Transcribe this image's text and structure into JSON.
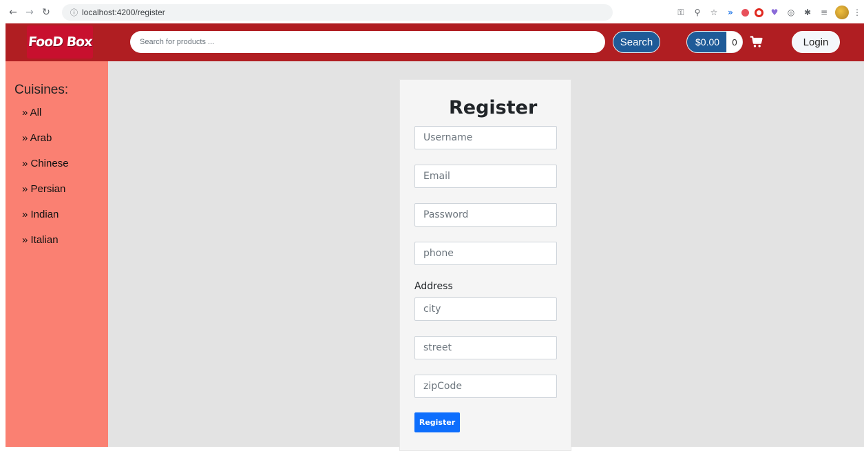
{
  "browser": {
    "url": "localhost:4200/register",
    "nav_icons": [
      "back-icon",
      "forward-icon",
      "reload-icon"
    ],
    "extension_icons": [
      "key-icon",
      "zoom-icon",
      "bookmark-star-icon",
      "extension-icon",
      "shield-icon",
      "opera-icon",
      "heart-icon",
      "extension-icon",
      "puzzle-icon",
      "reading-list-icon",
      "profile-avatar",
      "menu-icon"
    ]
  },
  "header": {
    "logo_text": "FooD Box",
    "search_placeholder": "Search for products ...",
    "search_label": "Search",
    "cart_total": "$0.00",
    "cart_count": "0",
    "login_label": "Login",
    "brand_color": "#b01e22",
    "accent_color": "#1f5b98"
  },
  "sidebar": {
    "title": "Cuisines:",
    "items": [
      "» All",
      "» Arab",
      "» Chinese",
      "» Persian",
      "» Indian",
      "» Italian"
    ],
    "background": "#fa8072"
  },
  "form": {
    "title": "Register",
    "username_placeholder": "Username",
    "email_placeholder": "Email",
    "password_placeholder": "Password",
    "phone_placeholder": "phone",
    "address_label": "Address",
    "city_placeholder": "city",
    "street_placeholder": "street",
    "zip_placeholder": "zipCode",
    "submit_label": "Register",
    "submit_color": "#0d6efd"
  }
}
